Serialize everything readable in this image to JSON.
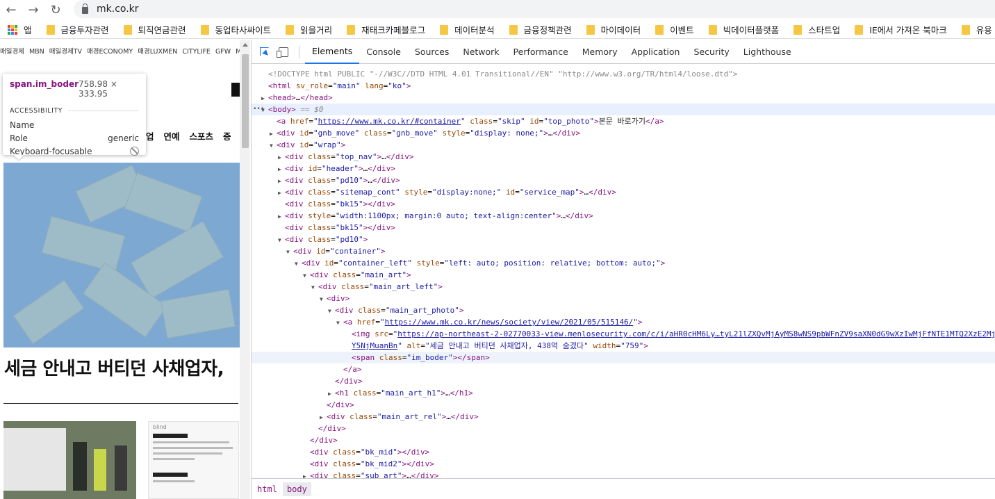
{
  "browser": {
    "url": "mk.co.kr",
    "bookmarks": [
      {
        "label": "앱",
        "type": "apps"
      },
      {
        "label": "금융투자관련",
        "type": "folder"
      },
      {
        "label": "퇴직연금관련",
        "type": "folder"
      },
      {
        "label": "동업타사싸이트",
        "type": "folder"
      },
      {
        "label": "읽을거리",
        "type": "folder"
      },
      {
        "label": "재태크카페블로그",
        "type": "folder"
      },
      {
        "label": "데이터분석",
        "type": "folder"
      },
      {
        "label": "금융정책관련",
        "type": "folder"
      },
      {
        "label": "마이데이터",
        "type": "folder"
      },
      {
        "label": "이벤트",
        "type": "folder"
      },
      {
        "label": "빅데이터플랫폼",
        "type": "folder"
      },
      {
        "label": "스타트업",
        "type": "folder"
      },
      {
        "label": "IE에서 가져온 북마크",
        "type": "folder"
      },
      {
        "label": "유용",
        "type": "folder"
      }
    ],
    "icons": {
      "back": "back-arrow-icon",
      "forward": "forward-arrow-icon",
      "reload": "reload-icon",
      "lock": "lock-icon",
      "folder": "folder-icon"
    }
  },
  "page": {
    "topnav": [
      "매일경제",
      "MBN",
      "매일경제TV",
      "매경ECONOMY",
      "매경LUXMEN",
      "CITYLIFE",
      "GFW",
      "M·"
    ],
    "menu": [
      "업",
      "연예",
      "스포츠",
      "증"
    ],
    "headline": "세금 안내고 버티던 사채업자,",
    "tooltip": {
      "tag": "span.im_boder",
      "size": "758.98 × 333.95",
      "section": "ACCESSIBILITY",
      "rows": [
        {
          "label": "Name",
          "value": ""
        },
        {
          "label": "Role",
          "value": "generic"
        },
        {
          "label": "Keyboard-focusable",
          "value": "",
          "icon": "not-allowed-icon"
        }
      ]
    },
    "thumb2_caption": "blind"
  },
  "devtools": {
    "tabs": [
      "Elements",
      "Console",
      "Sources",
      "Network",
      "Performance",
      "Memory",
      "Application",
      "Security",
      "Lighthouse"
    ],
    "active_tab": "Elements",
    "breadcrumbs": [
      "html",
      "body"
    ],
    "active_breadcrumb": "body",
    "dom_lines": [
      {
        "i": 0,
        "tri": "",
        "html": "<span class=\"cm\">&lt;!DOCTYPE html PUBLIC \"-//W3C//DTD HTML 4.01 Transitional//EN\" \"http://www.w3.org/TR/html4/loose.dtd\"&gt;</span>"
      },
      {
        "i": 0,
        "tri": "",
        "html": "<span class=\"t\">&lt;html</span> <span class=\"an\">sv_role</span>=<span class=\"av\">\"main\"</span> <span class=\"an\">lang</span>=<span class=\"av\">\"ko\"</span><span class=\"t\">&gt;</span>"
      },
      {
        "i": 0,
        "tri": "▶",
        "html": "<span class=\"t\">&lt;head&gt;</span>…<span class=\"t\">&lt;/head&gt;</span>"
      },
      {
        "i": 0,
        "tri": "▼",
        "html": "<span class=\"t\">&lt;body&gt;</span> <span class=\"eq\">== $0</span>",
        "sel": true,
        "dots": true
      },
      {
        "i": 1,
        "tri": "",
        "html": "<span class=\"t\">&lt;a</span> <span class=\"an\">href</span>=<span class=\"av\">\"<span class=\"lnk\">https://www.mk.co.kr/#container</span>\"</span> <span class=\"an\">class</span>=<span class=\"av\">\"skip\"</span> <span class=\"an\">id</span>=<span class=\"av\">\"top_photo\"</span><span class=\"t\">&gt;</span><span class=\"tx\">본문 바로가기</span><span class=\"t\">&lt;/a&gt;</span>"
      },
      {
        "i": 1,
        "tri": "▶",
        "html": "<span class=\"t\">&lt;div</span> <span class=\"an\">id</span>=<span class=\"av\">\"gnb_move\"</span> <span class=\"an\">class</span>=<span class=\"av\">\"gnb_move\"</span> <span class=\"an\">style</span>=<span class=\"av\">\"display: none;\"</span><span class=\"t\">&gt;</span>…<span class=\"t\">&lt;/div&gt;</span>"
      },
      {
        "i": 1,
        "tri": "▼",
        "html": "<span class=\"t\">&lt;div</span> <span class=\"an\">id</span>=<span class=\"av\">\"wrap\"</span><span class=\"t\">&gt;</span>"
      },
      {
        "i": 2,
        "tri": "▶",
        "html": "<span class=\"t\">&lt;div</span> <span class=\"an\">class</span>=<span class=\"av\">\"top_nav\"</span><span class=\"t\">&gt;</span>…<span class=\"t\">&lt;/div&gt;</span>"
      },
      {
        "i": 2,
        "tri": "▶",
        "html": "<span class=\"t\">&lt;div</span> <span class=\"an\">id</span>=<span class=\"av\">\"header\"</span><span class=\"t\">&gt;</span>…<span class=\"t\">&lt;/div&gt;</span>"
      },
      {
        "i": 2,
        "tri": "▶",
        "html": "<span class=\"t\">&lt;div</span> <span class=\"an\">class</span>=<span class=\"av\">\"pd10\"</span><span class=\"t\">&gt;</span>…<span class=\"t\">&lt;/div&gt;</span>"
      },
      {
        "i": 2,
        "tri": "▶",
        "html": "<span class=\"t\">&lt;div</span> <span class=\"an\">class</span>=<span class=\"av\">\"sitemap_cont\"</span> <span class=\"an\">style</span>=<span class=\"av\">\"display:none;\"</span> <span class=\"an\">id</span>=<span class=\"av\">\"service_map\"</span><span class=\"t\">&gt;</span>…<span class=\"t\">&lt;/div&gt;</span>"
      },
      {
        "i": 2,
        "tri": "",
        "html": "<span class=\"t\">&lt;div</span> <span class=\"an\">class</span>=<span class=\"av\">\"bk15\"</span><span class=\"t\">&gt;&lt;/div&gt;</span>"
      },
      {
        "i": 2,
        "tri": "▶",
        "html": "<span class=\"t\">&lt;div</span> <span class=\"an\">style</span>=<span class=\"av\">\"width:1100px; margin:0 auto; text-align:center\"</span><span class=\"t\">&gt;</span>…<span class=\"t\">&lt;/div&gt;</span>"
      },
      {
        "i": 2,
        "tri": "",
        "html": "<span class=\"t\">&lt;div</span> <span class=\"an\">class</span>=<span class=\"av\">\"bk15\"</span><span class=\"t\">&gt;&lt;/div&gt;</span>"
      },
      {
        "i": 2,
        "tri": "▼",
        "html": "<span class=\"t\">&lt;div</span> <span class=\"an\">class</span>=<span class=\"av\">\"pd10\"</span><span class=\"t\">&gt;</span>"
      },
      {
        "i": 3,
        "tri": "▼",
        "html": "<span class=\"t\">&lt;div</span> <span class=\"an\">id</span>=<span class=\"av\">\"container\"</span><span class=\"t\">&gt;</span>"
      },
      {
        "i": 4,
        "tri": "▼",
        "html": "<span class=\"t\">&lt;div</span> <span class=\"an\">id</span>=<span class=\"av\">\"container_left\"</span> <span class=\"an\">style</span>=<span class=\"av\">\"left: auto; position: relative; bottom: auto;\"</span><span class=\"t\">&gt;</span>"
      },
      {
        "i": 5,
        "tri": "▼",
        "html": "<span class=\"t\">&lt;div</span> <span class=\"an\">class</span>=<span class=\"av\">\"main_art\"</span><span class=\"t\">&gt;</span>"
      },
      {
        "i": 6,
        "tri": "▼",
        "html": "<span class=\"t\">&lt;div</span> <span class=\"an\">class</span>=<span class=\"av\">\"main_art_left\"</span><span class=\"t\">&gt;</span>"
      },
      {
        "i": 7,
        "tri": "▼",
        "html": "<span class=\"t\">&lt;div&gt;</span>"
      },
      {
        "i": 8,
        "tri": "▼",
        "html": "<span class=\"t\">&lt;div</span> <span class=\"an\">class</span>=<span class=\"av\">\"main_art_photo\"</span><span class=\"t\">&gt;</span>"
      },
      {
        "i": 9,
        "tri": "▼",
        "html": "<span class=\"t\">&lt;a</span> <span class=\"an\">href</span>=<span class=\"av\">\"<span class=\"lnk\">https://www.mk.co.kr/news/society/view/2021/05/515146/</span>\"</span><span class=\"t\">&gt;</span>"
      },
      {
        "i": 10,
        "tri": "",
        "html": "<span class=\"t\">&lt;img</span> <span class=\"an\">src</span>=<span class=\"av\">\"<span class=\"lnk\">https://ap-northeast-2-02770033-view.menlosecurity.com/c/i/aHR0cHM6Ly…tyL21lZXQvMjAyMS8wNS9pbWFnZV9saXN0dG9wXzIwMjFfNTE1MTQ2XzE2Mj</span></span>"
      },
      {
        "i": 10,
        "tri": "",
        "html": "<span class=\"av\"><span class=\"lnk\">Y5NjMuanBn</span>\"</span> <span class=\"an\">alt</span>=<span class=\"av\">\"세금 안내고 버티던 사채업자, 438억 숨겼다\"</span> <span class=\"an\">width</span>=<span class=\"av\">\"759\"</span><span class=\"t\">&gt;</span>"
      },
      {
        "i": 10,
        "tri": "",
        "html": "<span class=\"t\">&lt;span</span> <span class=\"an\">class</span>=<span class=\"av\">\"im_boder\"</span><span class=\"t\">&gt;&lt;/span&gt;</span>",
        "hover": true
      },
      {
        "i": 9,
        "tri": "",
        "html": "<span class=\"t\">&lt;/a&gt;</span>"
      },
      {
        "i": 8,
        "tri": "",
        "html": "<span class=\"t\">&lt;/div&gt;</span>"
      },
      {
        "i": 8,
        "tri": "▶",
        "html": "<span class=\"t\">&lt;h1</span> <span class=\"an\">class</span>=<span class=\"av\">\"main_art_h1\"</span><span class=\"t\">&gt;</span>…<span class=\"t\">&lt;/h1&gt;</span>"
      },
      {
        "i": 7,
        "tri": "",
        "html": "<span class=\"t\">&lt;/div&gt;</span>"
      },
      {
        "i": 7,
        "tri": "▶",
        "html": "<span class=\"t\">&lt;div</span> <span class=\"an\">class</span>=<span class=\"av\">\"main_art_rel\"</span><span class=\"t\">&gt;</span>…<span class=\"t\">&lt;/div&gt;</span>"
      },
      {
        "i": 6,
        "tri": "",
        "html": "<span class=\"t\">&lt;/div&gt;</span>"
      },
      {
        "i": 5,
        "tri": "",
        "html": "<span class=\"t\">&lt;/div&gt;</span>"
      },
      {
        "i": 5,
        "tri": "",
        "html": "<span class=\"t\">&lt;div</span> <span class=\"an\">class</span>=<span class=\"av\">\"bk_mid\"</span><span class=\"t\">&gt;&lt;/div&gt;</span>"
      },
      {
        "i": 5,
        "tri": "",
        "html": "<span class=\"t\">&lt;div</span> <span class=\"an\">class</span>=<span class=\"av\">\"bk_mid2\"</span><span class=\"t\">&gt;&lt;/div&gt;</span>"
      },
      {
        "i": 5,
        "tri": "▶",
        "html": "<span class=\"t\">&lt;div</span> <span class=\"an\">class</span>=<span class=\"av\">\"sub_art\"</span><span class=\"t\">&gt;</span>…<span class=\"t\">&lt;/div&gt;</span>"
      }
    ]
  },
  "colors": {
    "tag": "#881280",
    "attr_name": "#994500",
    "attr_value": "#1a1aa6",
    "accent": "#1a73e8",
    "folder": "#f6c744"
  }
}
